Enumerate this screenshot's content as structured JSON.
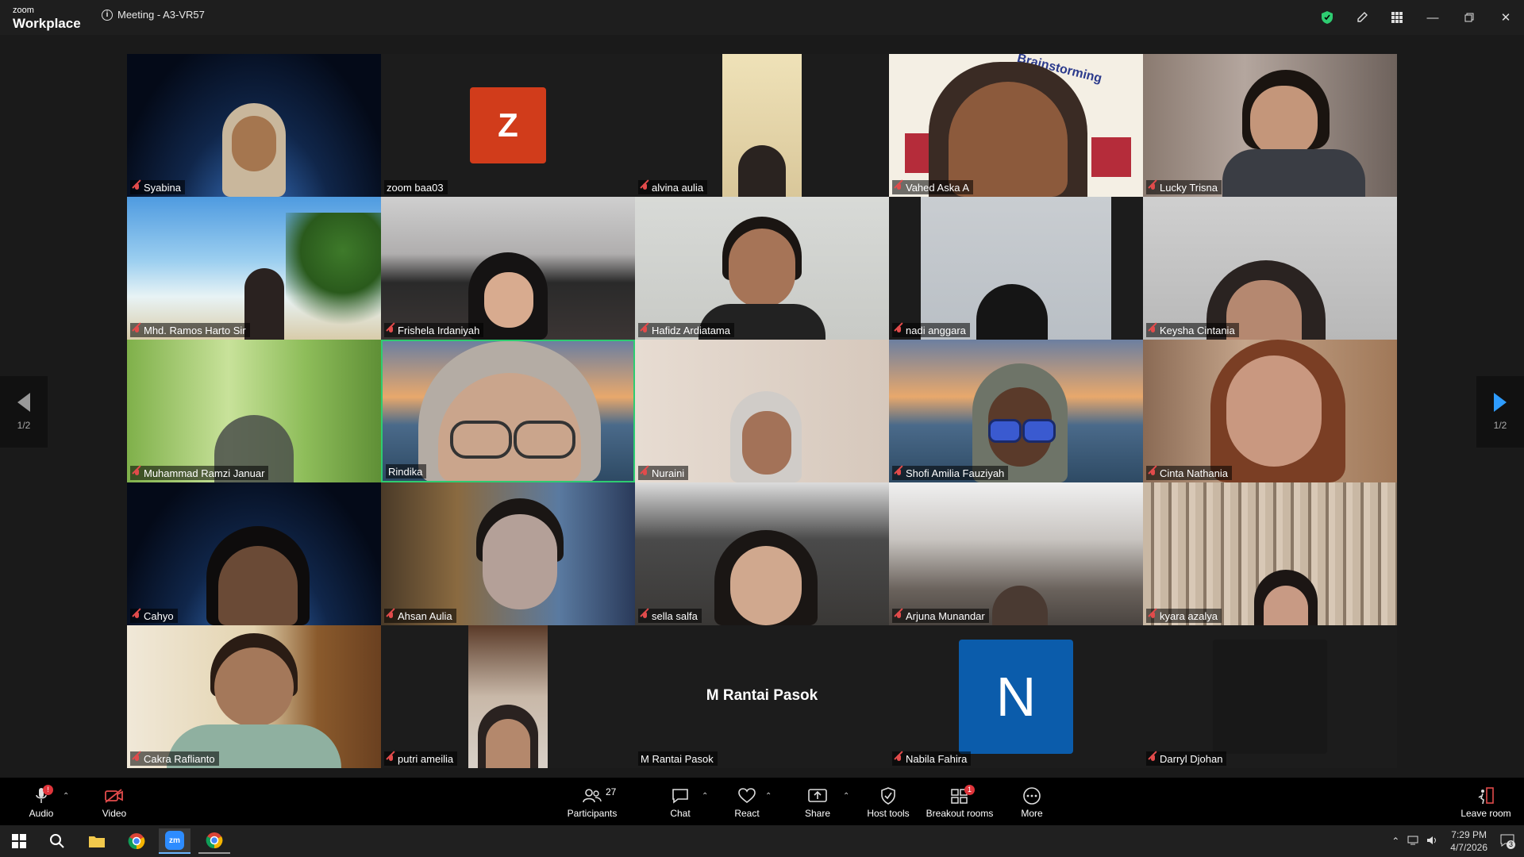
{
  "titlebar": {
    "brand_small": "zoom",
    "brand_big": "Workplace",
    "meeting_title": "Meeting - A3-VR57"
  },
  "colors": {
    "accent": "#2e9cff",
    "mute": "#e24b4b",
    "active_speaker": "#2ecc71",
    "avatar_z": "#d13c1b",
    "avatar_n": "#0b5cab"
  },
  "gallery": {
    "page_left": "1/2",
    "page_right": "1/2",
    "participants": [
      {
        "name": "Syabina",
        "muted": true
      },
      {
        "name": "zoom baa03",
        "muted": false,
        "avatar": "Z"
      },
      {
        "name": "alvina aulia",
        "muted": true
      },
      {
        "name": "Vahed Aska A",
        "muted": true,
        "banner": "Brainstorming"
      },
      {
        "name": "Lucky Trisna",
        "muted": true
      },
      {
        "name": "Mhd. Ramos Harto Sir",
        "muted": true
      },
      {
        "name": "Frishela Irdaniyah",
        "muted": true
      },
      {
        "name": "Hafidz Ardiatama",
        "muted": true
      },
      {
        "name": "nadi anggara",
        "muted": true
      },
      {
        "name": "Keysha Cintania",
        "muted": true
      },
      {
        "name": "Muhammad Ramzi Januar",
        "muted": true
      },
      {
        "name": "Rindika",
        "muted": false,
        "active": true
      },
      {
        "name": "Nuraini",
        "muted": true
      },
      {
        "name": "Shofi Amilia Fauziyah",
        "muted": true
      },
      {
        "name": "Cinta Nathania",
        "muted": true
      },
      {
        "name": "Cahyo",
        "muted": true
      },
      {
        "name": "Ahsan Aulia",
        "muted": true
      },
      {
        "name": "sella salfa",
        "muted": true
      },
      {
        "name": "Arjuna Munandar",
        "muted": true
      },
      {
        "name": "kyara azalya",
        "muted": true
      },
      {
        "name": "Cakra Raflianto",
        "muted": true
      },
      {
        "name": "putri ameilia",
        "muted": true
      },
      {
        "name": "M Rantai Pasok",
        "muted": false,
        "center_name": "M Rantai Pasok"
      },
      {
        "name": "Nabila Fahira",
        "muted": true,
        "avatar": "N"
      },
      {
        "name": "Darryl Djohan",
        "muted": true
      }
    ]
  },
  "toolbar": {
    "audio": "Audio",
    "video": "Video",
    "participants": "Participants",
    "participants_count": "27",
    "chat": "Chat",
    "react": "React",
    "share": "Share",
    "host_tools": "Host tools",
    "breakout_rooms": "Breakout rooms",
    "breakout_badge": "1",
    "more": "More",
    "leave": "Leave room"
  },
  "taskbar": {
    "time": "7:29 PM",
    "date": "4/7/2026",
    "notif_count": "3"
  }
}
